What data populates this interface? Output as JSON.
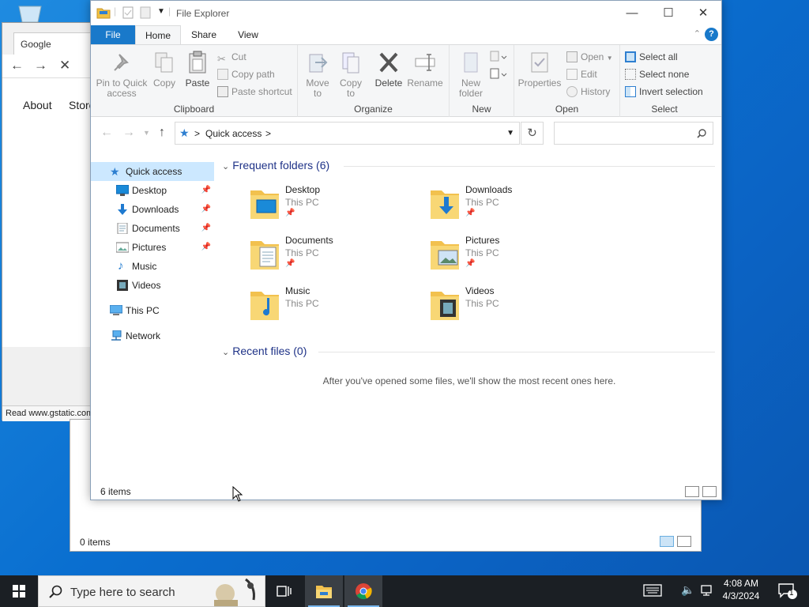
{
  "chrome": {
    "tab_title": "Google",
    "links": [
      "About",
      "Store"
    ],
    "status": "Read www.gstatic.com"
  },
  "back_window": {
    "status": "0 items"
  },
  "explorer": {
    "title": "File Explorer",
    "ribbon_tabs": [
      "File",
      "Home",
      "Share",
      "View"
    ],
    "help_label": "?",
    "groups": {
      "clipboard": {
        "label": "Clipboard",
        "pin_label_1": "Pin to Quick",
        "pin_label_2": "access",
        "copy": "Copy",
        "paste": "Paste",
        "cut": "Cut",
        "copy_path": "Copy path",
        "paste_shortcut": "Paste shortcut"
      },
      "organize": {
        "label": "Organize",
        "move_to_1": "Move",
        "move_to_2": "to",
        "copy_to_1": "Copy",
        "copy_to_2": "to",
        "delete": "Delete",
        "rename": "Rename"
      },
      "new": {
        "label": "New",
        "new_folder_1": "New",
        "new_folder_2": "folder"
      },
      "open": {
        "label": "Open",
        "properties": "Properties",
        "open": "Open",
        "edit": "Edit",
        "history": "History"
      },
      "select": {
        "label": "Select",
        "select_all": "Select all",
        "select_none": "Select none",
        "invert": "Invert selection"
      }
    },
    "address": {
      "location": "Quick access",
      "separator": ">"
    },
    "nav": {
      "quick_access": "Quick access",
      "items": [
        {
          "label": "Desktop",
          "pinned": true
        },
        {
          "label": "Downloads",
          "pinned": true
        },
        {
          "label": "Documents",
          "pinned": true
        },
        {
          "label": "Pictures",
          "pinned": true
        },
        {
          "label": "Music",
          "pinned": false
        },
        {
          "label": "Videos",
          "pinned": false
        }
      ],
      "this_pc": "This PC",
      "network": "Network"
    },
    "frequent_header": "Frequent folders (6)",
    "folders": [
      {
        "name": "Desktop",
        "location": "This PC",
        "pinned": true
      },
      {
        "name": "Downloads",
        "location": "This PC",
        "pinned": true
      },
      {
        "name": "Documents",
        "location": "This PC",
        "pinned": true
      },
      {
        "name": "Pictures",
        "location": "This PC",
        "pinned": true
      },
      {
        "name": "Music",
        "location": "This PC",
        "pinned": false
      },
      {
        "name": "Videos",
        "location": "This PC",
        "pinned": false
      }
    ],
    "recent_header": "Recent files (0)",
    "empty_message": "After you've opened some files, we'll show the most recent ones here.",
    "status": "6 items"
  },
  "taskbar": {
    "search_placeholder": "Type here to search",
    "time": "4:08 AM",
    "date": "4/3/2024",
    "notification_count": "1"
  },
  "colors": {
    "accent": "#1979ca",
    "selected": "#cce8ff",
    "header_text": "#1e3287",
    "taskbar": "#1b1f24"
  }
}
